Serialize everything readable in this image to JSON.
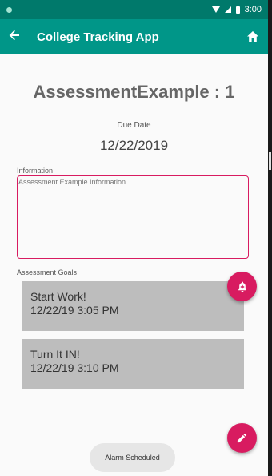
{
  "status_bar": {
    "time": "3:00"
  },
  "app_bar": {
    "title": "College Tracking App",
    "back_icon": "arrow-left-icon",
    "home_icon": "home-icon"
  },
  "assessment": {
    "heading": "AssessmentExample : 1",
    "due_label": "Due Date",
    "due_date": "12/22/2019",
    "info_label": "Information",
    "info_text": "Assessment Example Information",
    "goals_label": "Assessment Goals",
    "goals": [
      {
        "name": "Start Work!",
        "time": "12/22/19 3:05 PM"
      },
      {
        "name": "Turn It IN!",
        "time": "12/22/19 3:10 PM"
      }
    ]
  },
  "fabs": {
    "alarm_icon": "alarm-bell-icon",
    "edit_icon": "pencil-icon"
  },
  "toast": {
    "message": "Alarm Scheduled"
  },
  "colors": {
    "status_bar": "#00796b",
    "app_bar": "#009688",
    "accent": "#d81b60",
    "card": "#bdbdbd"
  }
}
